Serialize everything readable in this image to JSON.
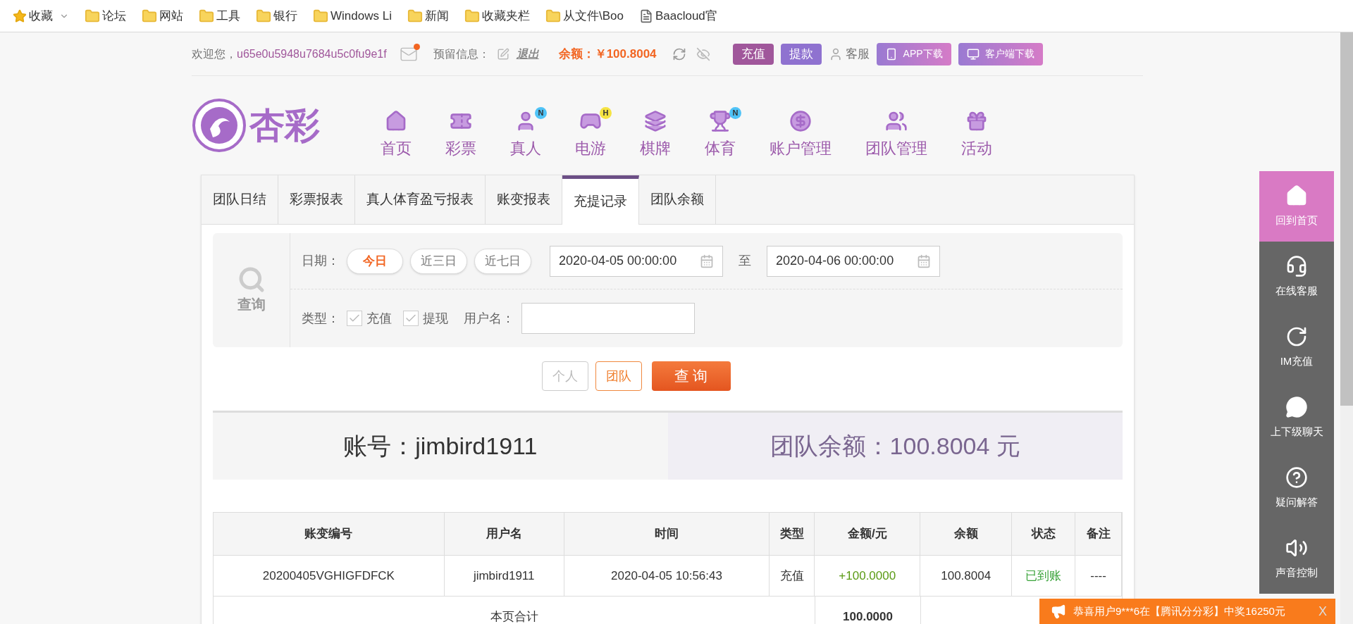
{
  "bookmarks": [
    {
      "kind": "star",
      "label": "收藏"
    },
    {
      "kind": "folder",
      "label": "论坛"
    },
    {
      "kind": "folder",
      "label": "网站"
    },
    {
      "kind": "folder",
      "label": "工具"
    },
    {
      "kind": "folder",
      "label": "银行"
    },
    {
      "kind": "folder",
      "label": "Windows Li"
    },
    {
      "kind": "folder",
      "label": "新闻"
    },
    {
      "kind": "folder",
      "label": "收藏夹栏"
    },
    {
      "kind": "folder",
      "label": "从文件\\Boo"
    },
    {
      "kind": "doc",
      "label": "Baacloud官"
    }
  ],
  "top_bar": {
    "greeting": "欢迎您，",
    "username": "u65e0u5948u7684u5c0fu9e1f",
    "mail_unread": true,
    "reserved_label": "预留信息：",
    "logout": "退出",
    "balance": "余额：￥100.8004",
    "buttons": [
      {
        "kind": "deposit",
        "label": "充值"
      },
      {
        "kind": "withdraw",
        "label": "提款"
      },
      {
        "kind": "service",
        "label": "客服"
      },
      {
        "kind": "app",
        "label": "APP下载"
      },
      {
        "kind": "client",
        "label": "客户端下载"
      }
    ]
  },
  "logo": "杏彩",
  "nav": [
    {
      "label": "首页"
    },
    {
      "label": "彩票"
    },
    {
      "label": "真人",
      "badge": "N",
      "color": "#4fc3f7"
    },
    {
      "label": "电游",
      "badge": "H",
      "color": "#f5e342"
    },
    {
      "label": "棋牌"
    },
    {
      "label": "体育",
      "badge": "N",
      "color": "#4fc3f7"
    },
    {
      "label": "账户管理"
    },
    {
      "label": "团队管理"
    },
    {
      "label": "活动"
    }
  ],
  "tabs": [
    {
      "label": "团队日结",
      "selected": false
    },
    {
      "label": "彩票报表",
      "selected": false
    },
    {
      "label": "真人体育盈亏报表",
      "selected": false
    },
    {
      "label": "账变报表",
      "selected": false
    },
    {
      "label": "充提记录",
      "selected": true
    },
    {
      "label": "团队余额",
      "selected": false
    }
  ],
  "filter": {
    "search_label": "查询",
    "date_label": "日期：",
    "ranges": [
      {
        "label": "今日",
        "selected": true
      },
      {
        "label": "近三日",
        "selected": false
      },
      {
        "label": "近七日",
        "selected": false
      }
    ],
    "date_from": "2020-04-05 00:00:00",
    "to_label": "至",
    "date_to": "2020-04-06 00:00:00",
    "type_label": "类型：",
    "types": [
      {
        "label": "充值",
        "checked": true
      },
      {
        "label": "提现",
        "checked": true
      }
    ],
    "username_label": "用户名：",
    "scopes": [
      {
        "label": "个人",
        "selected": false
      },
      {
        "label": "团队",
        "selected": true
      }
    ],
    "submit": "查 询"
  },
  "summary": {
    "account": "账号：jimbird1911",
    "team_balance": "团队余额：100.8004 元"
  },
  "table": {
    "columns": [
      "账变编号",
      "用户名",
      "时间",
      "类型",
      "金额/元",
      "余额",
      "状态",
      "备注"
    ],
    "rows": [
      [
        "20200405VGHIGFDFCK",
        "jimbird1911",
        "2020-04-05 10:56:43",
        "充值",
        "+100.0000",
        "100.8004",
        "已到账",
        "----"
      ]
    ],
    "total_label": "本页合计",
    "total_amount": "100.0000"
  },
  "side_menu": [
    {
      "label": "回到首页",
      "selected": true
    },
    {
      "label": "在线客服",
      "selected": false
    },
    {
      "label": "IM充值",
      "selected": false
    },
    {
      "label": "上下级聊天",
      "selected": false
    },
    {
      "label": "疑问解答",
      "selected": false
    },
    {
      "label": "声音控制",
      "selected": false
    }
  ],
  "notice": {
    "text": "恭喜用户9***6在【腾讯分分彩】中奖16250元",
    "close": "X"
  }
}
